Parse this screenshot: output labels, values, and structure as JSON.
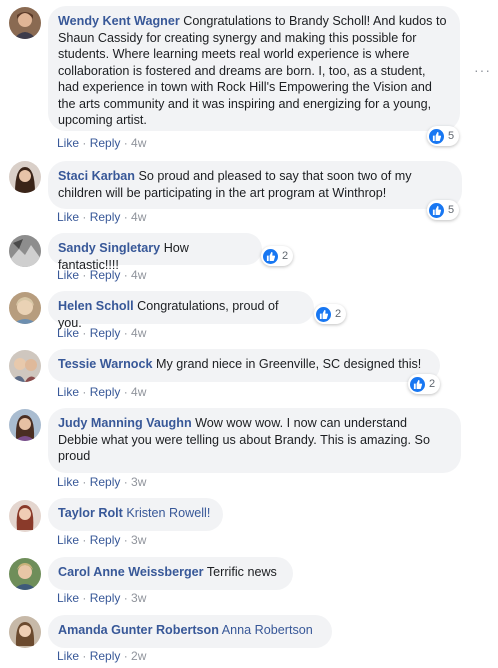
{
  "comments": [
    {
      "name": "Wendy Kent Wagner",
      "text": "Congratulations to Brandy Scholl! And kudos to Shaun Cassidy for creating synergy and making this possible for students. Where learning meets real world experience is where collaboration is fostered and dreams are born. I, too, as a student, had experience in town with Rock Hill's Empowering the Vision and the arts community and it was inspiring and energizing for a young, upcoming artist.",
      "like": "Like",
      "reply": "Reply",
      "time": "4w",
      "reactions": "5",
      "more": "···"
    },
    {
      "name": "Staci Karban",
      "text": "So proud and pleased to say that soon two of my children will be participating in the art program at Winthrop!",
      "like": "Like",
      "reply": "Reply",
      "time": "4w",
      "reactions": "5"
    },
    {
      "name": "Sandy Singletary",
      "text": "How fantastic!!!!",
      "like": "Like",
      "reply": "Reply",
      "time": "4w",
      "reactions": "2"
    },
    {
      "name": "Helen Scholl",
      "text": "Congratulations, proud of you.",
      "like": "Like",
      "reply": "Reply",
      "time": "4w",
      "reactions": "2"
    },
    {
      "name": "Tessie Warnock",
      "text": "My grand niece in Greenville, SC designed this!",
      "like": "Like",
      "reply": "Reply",
      "time": "4w",
      "reactions": "2"
    },
    {
      "name": "Judy Manning Vaughn",
      "text": "Wow wow wow. I now can understand Debbie what you were telling us about Brandy. This is amazing. So proud",
      "like": "Like",
      "reply": "Reply",
      "time": "3w"
    },
    {
      "name": "Taylor Rolt",
      "text": "Kristen Rowell!",
      "like": "Like",
      "reply": "Reply",
      "time": "3w"
    },
    {
      "name": "Carol Anne Weissberger",
      "text": "Terrific news",
      "like": "Like",
      "reply": "Reply",
      "time": "3w"
    },
    {
      "name": "Amanda Gunter Robertson",
      "text": "Anna Robertson",
      "like": "Like",
      "reply": "Reply",
      "time": "2w"
    }
  ],
  "colors": {
    "name": "#385898",
    "bubble": "#f2f3f5",
    "like_blue": "#1877f2",
    "meta": "#90949c"
  }
}
